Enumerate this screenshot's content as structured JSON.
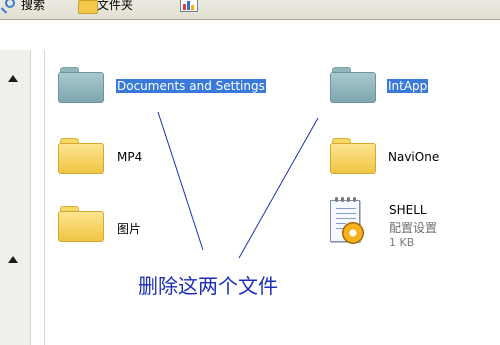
{
  "toolbar": {
    "search_label": "搜索",
    "folders_label": "文件夹",
    "search_icon": "search-icon",
    "folders_icon": "folder-icon",
    "views_icon": "views-icon"
  },
  "nav": {
    "scroll_up_icon": "arrow-up-icon"
  },
  "items": [
    {
      "name": "Documents and Settings",
      "type": "folder",
      "color": "#8fb5bd",
      "selected": true
    },
    {
      "name": "IntApp",
      "type": "folder",
      "color": "#8fb5bd",
      "selected": true
    },
    {
      "name": "MP4",
      "type": "folder",
      "color": "#f2c94c",
      "selected": false
    },
    {
      "name": "NaviOne",
      "type": "folder",
      "color": "#f2c94c",
      "selected": false
    },
    {
      "name": "图片",
      "type": "folder",
      "color": "#f2c94c",
      "selected": false
    },
    {
      "name": "SHELL",
      "type": "file",
      "subtype": "配置设置",
      "size": "1 KB",
      "icon": "ini-settings-icon",
      "selected": false
    }
  ],
  "annotation": {
    "text": "删除这两个文件",
    "color": "#1d2fb5"
  },
  "colors": {
    "selection": "#3879d9",
    "annotation_lines": "#1d2fb5"
  }
}
